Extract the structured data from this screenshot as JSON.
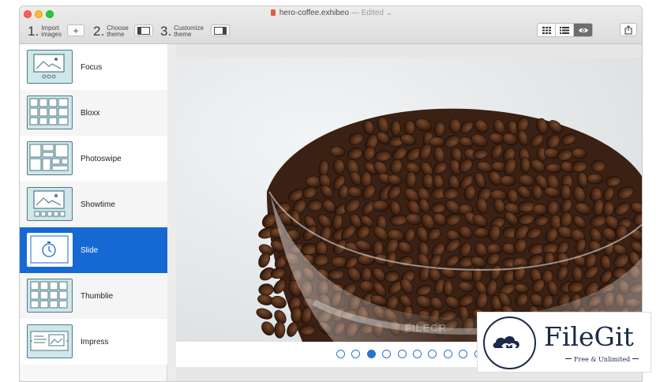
{
  "window": {
    "title": "hero-coffee.exhibeo",
    "edited_label": "— Edited ⌄"
  },
  "toolbar": {
    "steps": [
      {
        "num": "1.",
        "label": "Import images"
      },
      {
        "num": "2.",
        "label": "Choose theme"
      },
      {
        "num": "3.",
        "label": "Customize theme"
      }
    ],
    "add_button_label": "+"
  },
  "themes": [
    {
      "name": "Focus"
    },
    {
      "name": "Bloxx"
    },
    {
      "name": "Photoswipe"
    },
    {
      "name": "Showtime"
    },
    {
      "name": "Slide",
      "selected": true
    },
    {
      "name": "Thumblie"
    },
    {
      "name": "Impress"
    }
  ],
  "slideshow": {
    "dot_count": 11,
    "active_dot": 3
  },
  "watermarks": {
    "image_mark": "FILECR",
    "brand_name": "FileGit",
    "brand_tagline": "Free & Unlimited"
  },
  "colors": {
    "selection": "#1669d3",
    "accent": "#2a73d0"
  }
}
